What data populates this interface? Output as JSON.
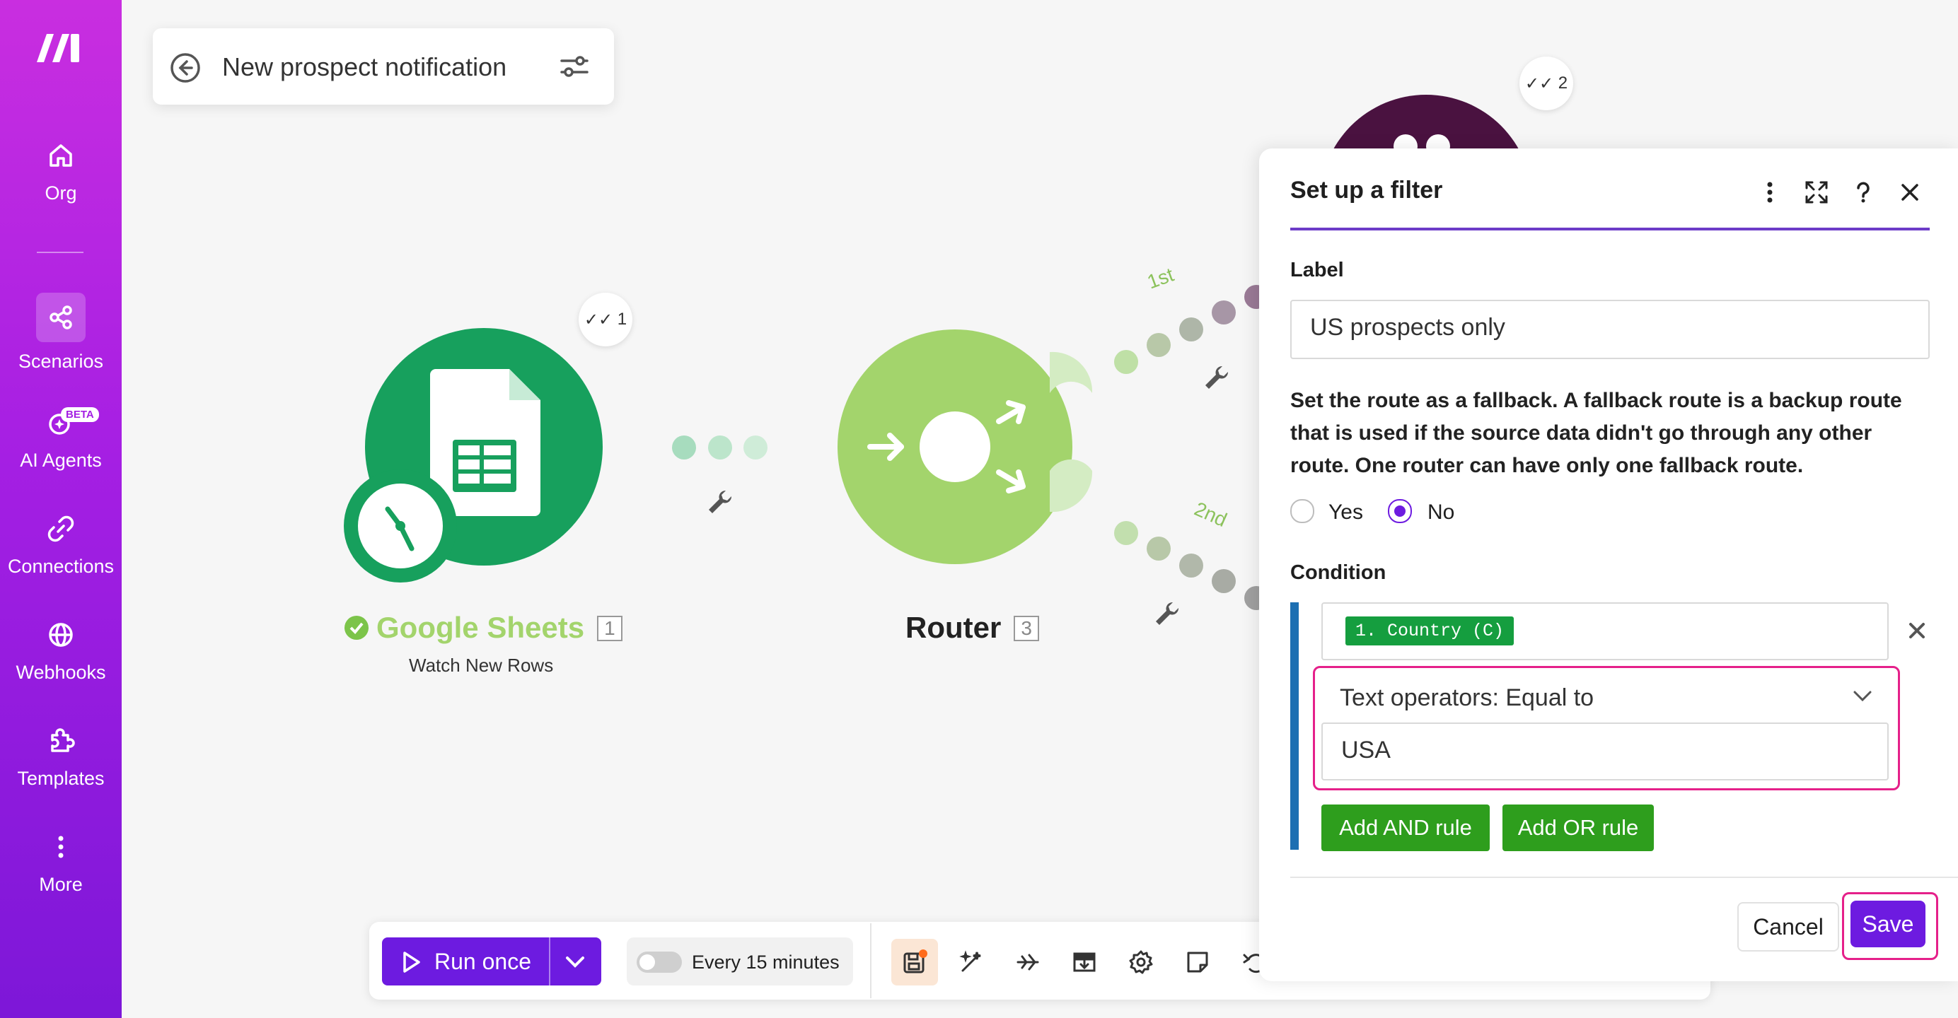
{
  "scenario": {
    "title": "New prospect notification"
  },
  "sidebar": {
    "items": [
      {
        "label": "Org",
        "icon": "home-icon"
      },
      {
        "label": "Scenarios",
        "icon": "share-nodes-icon"
      },
      {
        "label": "AI Agents",
        "icon": "sparkle-agent-icon",
        "badge": "BETA"
      },
      {
        "label": "Connections",
        "icon": "link-icon"
      },
      {
        "label": "Webhooks",
        "icon": "globe-icon"
      },
      {
        "label": "Templates",
        "icon": "puzzle-icon"
      },
      {
        "label": "More",
        "icon": "more-vertical-icon"
      }
    ]
  },
  "canvas": {
    "modules": [
      {
        "name": "Google Sheets",
        "subtitle": "Watch New Rows",
        "number": "1",
        "badge": "1",
        "color": "#17a05d"
      },
      {
        "name": "Router",
        "number": "3",
        "color": "#a3d46c"
      },
      {
        "badge": "2",
        "color": "#4a1240"
      }
    ],
    "routes": [
      {
        "label": "1st"
      },
      {
        "label": "2nd"
      }
    ]
  },
  "toolbar": {
    "run_label": "Run once",
    "schedule_label": "Every 15 minutes",
    "tools": [
      "save-icon",
      "magic-wand-icon",
      "airplane-icon",
      "export-icon",
      "settings-icon",
      "note-icon",
      "undo-icon"
    ]
  },
  "filter_panel": {
    "title": "Set up a filter",
    "label_heading": "Label",
    "label_value": "US prospects only",
    "fallback_text": "Set the route as a fallback. A fallback route is a backup route that is used if the source data didn't go through any other route. One router can have only one fallback route.",
    "fallback_options": [
      {
        "label": "Yes",
        "selected": false
      },
      {
        "label": "No",
        "selected": true
      }
    ],
    "condition_heading": "Condition",
    "condition": {
      "field_chip": "1. Country (C)",
      "operator": "Text operators: Equal to",
      "value": "USA"
    },
    "add_and_label": "Add AND rule",
    "add_or_label": "Add OR rule",
    "cancel_label": "Cancel",
    "save_label": "Save"
  },
  "colors": {
    "accent": "#6d1be0",
    "highlight": "#e5208a",
    "green_button": "#2e9e1d",
    "chip": "#159e3f"
  }
}
